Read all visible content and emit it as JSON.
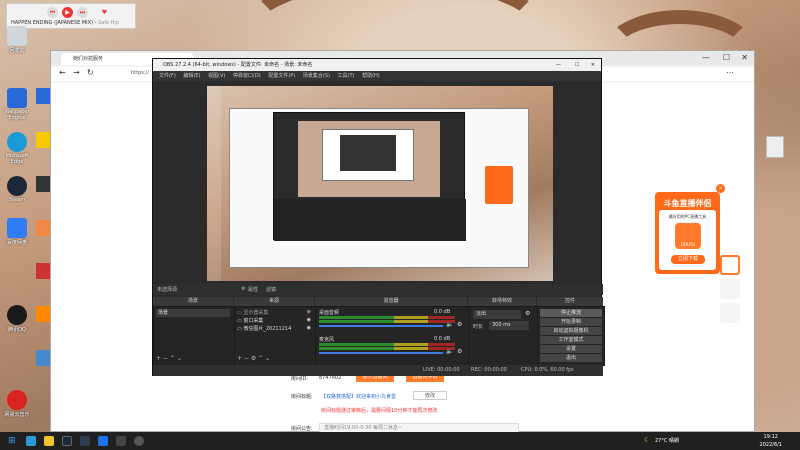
{
  "music": {
    "track": "HAPPEN ENDING (JAPANESE MIX)",
    "artist": "Safe Hip"
  },
  "desktop_icons": [
    {
      "label": "回收站",
      "color": "#cccccc"
    },
    {
      "label": "Wallpaper Engine",
      "color": "#2a6ad8"
    },
    {
      "label": "Microsoft Edge",
      "color": "#1a9ad6"
    },
    {
      "label": "Steam",
      "color": "#1b2838"
    },
    {
      "label": "百度网盘",
      "color": "#2f7cf6"
    },
    {
      "label": "腾讯QQ",
      "color": "#1a1a1a"
    },
    {
      "label": "网易云音乐",
      "color": "#d8231e"
    }
  ],
  "browser": {
    "tab_title": "她们对抗服务",
    "url": "https://"
  },
  "obs": {
    "title": "OBS 27.2.4 (64-bit, windows) - 配置文件: 未命名 - 场景: 未命名",
    "menu": [
      "文件(F)",
      "编辑(E)",
      "视图(V)",
      "停靠窗口(D)",
      "配置文件(P)",
      "场景集合(S)",
      "工具(T)",
      "帮助(H)"
    ],
    "preview_bar": {
      "label": "未选择源",
      "props": "属性",
      "filters": "滤镜"
    },
    "docks": {
      "scenes": {
        "title": "场景",
        "item": "场景"
      },
      "sources": {
        "title": "来源",
        "items": [
          "显示器采集",
          "窗口采集",
          "微信图片_20211214"
        ]
      },
      "mixer": {
        "title": "混音器",
        "tracks": [
          {
            "name": "桌面音频",
            "db": "0.0 dB"
          },
          {
            "name": "麦克风",
            "db": "0.0 dB"
          }
        ]
      },
      "transitions": {
        "title": "转场特效",
        "type": "淡出",
        "duration_label": "时长",
        "duration": "300 ms"
      },
      "controls": {
        "title": "控件",
        "buttons": [
          "停止推流",
          "开始录制",
          "启动虚拟摄像机",
          "工作室模式",
          "设置",
          "退出"
        ]
      }
    },
    "status": {
      "live": "LIVE: 00:00:00",
      "rec": "REC: 00:00:00",
      "cpu": "CPU: 0.0%, 60.00 fps"
    }
  },
  "webpage": {
    "room_id_label": "房间ID:",
    "room_id": "8747602",
    "enter_btn": "进入直播间",
    "apply_btn": "直播间申诉",
    "room_title_label": "房间标题:",
    "room_title": "【双路救搭配】欢迎来到小丸食堂",
    "edit_btn": "修改",
    "room_title_note": "房间标题通过审核后，需要间隔10分钟才能再次修改",
    "notice_label": "房间公告:",
    "notice_placeholder": "直播时间19:00-0:30 每周二休息~"
  },
  "douyu": {
    "head": "斗鱼直播伴侣",
    "subtitle": "最好用的PC直播工具",
    "logo": "DOUYU",
    "download": "立即下载"
  },
  "taskbar": {
    "weather": "27°C 晴朗",
    "time": "19:12",
    "date": "2022/6/1"
  }
}
